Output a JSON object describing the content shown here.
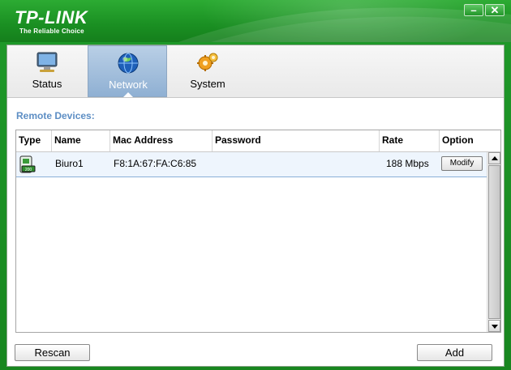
{
  "window": {
    "brand": "TP-LINK",
    "tagline": "The Reliable Choice",
    "minimize_glyph": "–",
    "close_glyph": "✕",
    "colors": {
      "frame": "#1f9a2a",
      "accent": "#5d8ec4"
    }
  },
  "tabs": [
    {
      "label": "Status",
      "icon": "monitor-icon",
      "active": false
    },
    {
      "label": "Network",
      "icon": "globe-icon",
      "active": true
    },
    {
      "label": "System",
      "icon": "gears-icon",
      "active": false
    }
  ],
  "section": {
    "title": "Remote Devices:"
  },
  "table": {
    "columns": [
      "Type",
      "Name",
      "Mac Address",
      "Password",
      "Rate",
      "Option"
    ],
    "rows": [
      {
        "type_icon": "powerline-adapter-icon",
        "name": "Biuro1",
        "mac": "F8:1A:67:FA:C6:85",
        "password": "",
        "rate": "188 Mbps",
        "option_label": "Modify"
      }
    ]
  },
  "buttons": {
    "rescan": "Rescan",
    "add": "Add"
  }
}
